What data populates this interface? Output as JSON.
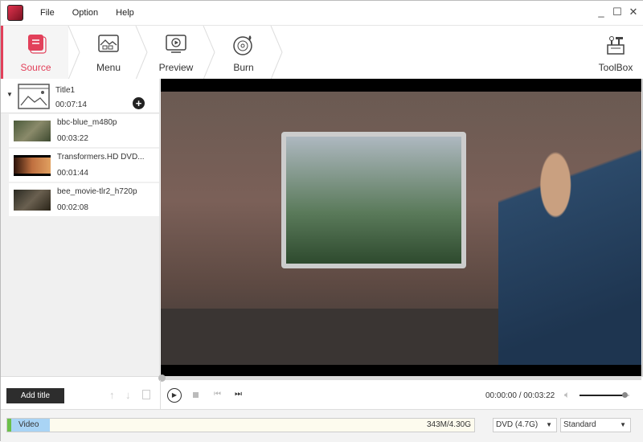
{
  "menu": {
    "items": [
      "File",
      "Option",
      "Help"
    ]
  },
  "steps": [
    {
      "label": "Source",
      "active": true
    },
    {
      "label": "Menu"
    },
    {
      "label": "Preview"
    },
    {
      "label": "Burn"
    }
  ],
  "toolbox": {
    "label": "ToolBox"
  },
  "title": {
    "name": "Title1",
    "duration": "00:07:14"
  },
  "clips": [
    {
      "name": "bbc-blue_m480p",
      "duration": "00:03:22"
    },
    {
      "name": "Transformers.HD DVD...",
      "duration": "00:01:44"
    },
    {
      "name": "bee_movie-tlr2_h720p",
      "duration": "00:02:08"
    }
  ],
  "controls": {
    "add_title": "Add title",
    "time": "00:00:00 / 00:03:22",
    "volume": 0.9,
    "progress": 0
  },
  "bottom": {
    "video_label": "Video",
    "usage": "343M/4.30G",
    "usage_fraction": 0.08,
    "disc": "DVD (4.7G)",
    "quality": "Standard"
  },
  "colors": {
    "accent": "#e2405a",
    "video_bar": "#a9d4f5",
    "green": "#6cc04a"
  }
}
